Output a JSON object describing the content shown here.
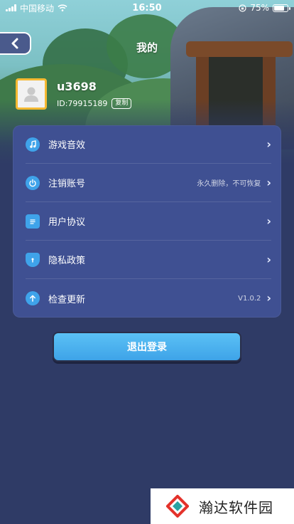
{
  "status_bar": {
    "carrier": "中国移动",
    "time": "16:50",
    "battery_percent": "75%"
  },
  "header": {
    "title": "我的",
    "back_icon": "chevron-left-icon"
  },
  "profile": {
    "username": "u3698",
    "user_id": "ID:79915189",
    "copy_label": "复制",
    "avatar_icon": "user-avatar-icon"
  },
  "settings": {
    "items": [
      {
        "label": "游戏音效",
        "value": "",
        "icon": "music-note-icon"
      },
      {
        "label": "注销账号",
        "value": "永久删除，不可恢复",
        "icon": "power-icon"
      },
      {
        "label": "用户协议",
        "value": "",
        "icon": "document-icon"
      },
      {
        "label": "隐私政策",
        "value": "",
        "icon": "shield-icon"
      },
      {
        "label": "检查更新",
        "value": "V1.0.2",
        "icon": "arrow-up-icon"
      }
    ]
  },
  "logout": {
    "label": "退出登录"
  },
  "watermark": {
    "text": "瀚达软件园"
  },
  "colors": {
    "background": "#2f3b66",
    "card": "#3f5092",
    "accent_blue": "#3fa3ea",
    "avatar_border": "#f5b932"
  }
}
